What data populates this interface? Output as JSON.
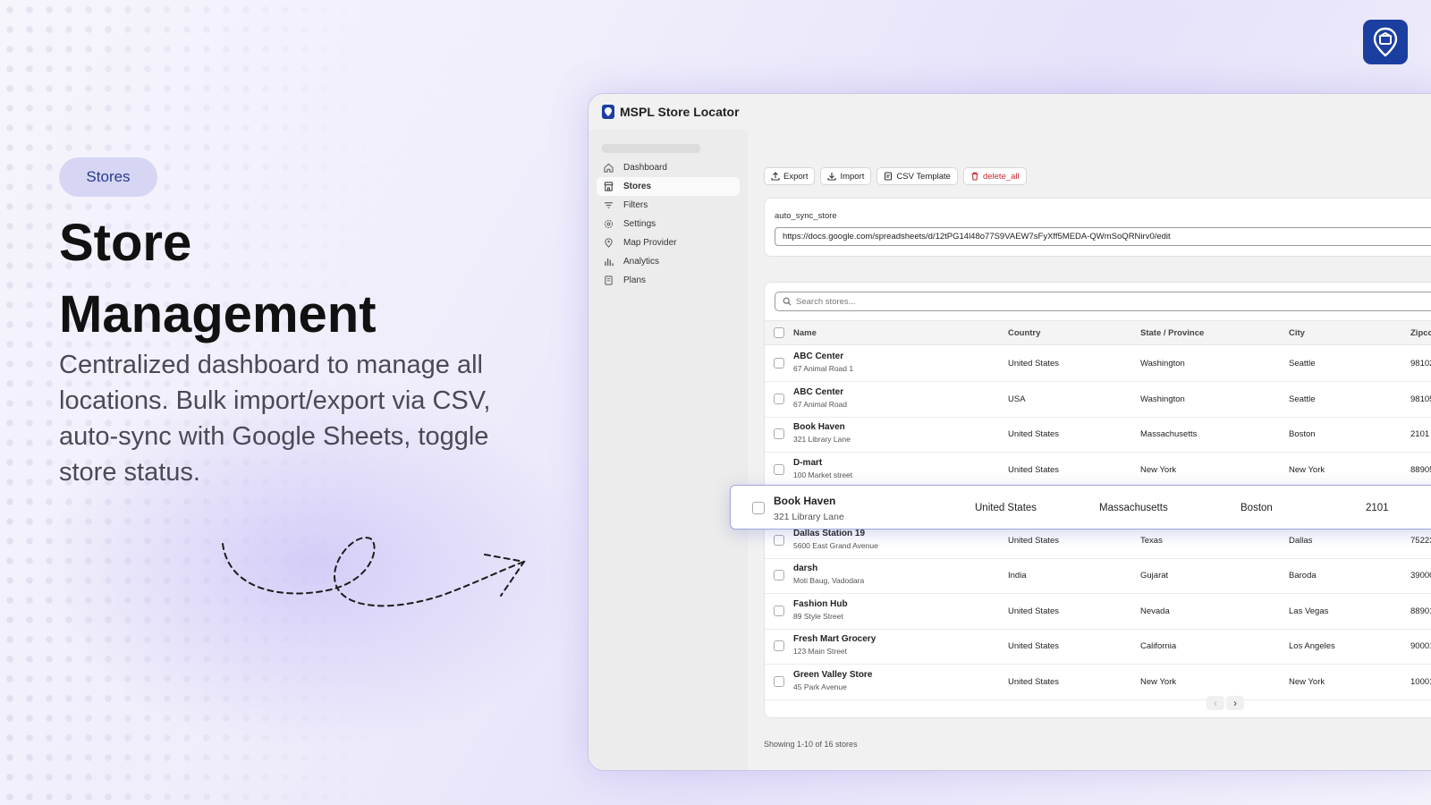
{
  "promo": {
    "pill": "Stores",
    "headline_line1": "Store",
    "headline_line2": "Management",
    "description": "Centralized dashboard to manage all locations. Bulk import/export via CSV, auto-sync with Google Sheets, toggle store status."
  },
  "app": {
    "title": "MSPL Store Locator",
    "sidebar": {
      "items": [
        {
          "label": "Dashboard",
          "icon": "home-icon"
        },
        {
          "label": "Stores",
          "icon": "store-icon",
          "active": true
        },
        {
          "label": "Filters",
          "icon": "filter-icon"
        },
        {
          "label": "Settings",
          "icon": "gear-icon"
        },
        {
          "label": "Map Provider",
          "icon": "pin-icon"
        },
        {
          "label": "Analytics",
          "icon": "bar-chart-icon"
        },
        {
          "label": "Plans",
          "icon": "document-icon"
        }
      ]
    },
    "toolbar": {
      "export": "Export",
      "import": "Import",
      "csv_template": "CSV Template",
      "delete_all": "delete_all"
    },
    "sync": {
      "label": "auto_sync_store",
      "value": "https://docs.google.com/spreadsheets/d/12tPG14l48o77S9VAEW7sFyXff5MEDA-QWmSoQRNirv0/edit"
    },
    "search": {
      "placeholder": "Search stores..."
    },
    "table": {
      "headers": {
        "name": "Name",
        "country": "Country",
        "state": "State / Province",
        "city": "City",
        "zip": "Zipco"
      },
      "rows": [
        {
          "name": "ABC Center",
          "address": "67 Animal Road 1",
          "country": "United States",
          "state": "Washington",
          "city": "Seattle",
          "zip": "98102"
        },
        {
          "name": "ABC Center",
          "address": "67 Animal Road",
          "country": "USA",
          "state": "Washington",
          "city": "Seattle",
          "zip": "98105"
        },
        {
          "name": "Book Haven",
          "address": "321 Library Lane",
          "country": "United States",
          "state": "Massachusetts",
          "city": "Boston",
          "zip": "2101"
        },
        {
          "name": "D-mart",
          "address": "100 Market street",
          "country": "United States",
          "state": "New York",
          "city": "New York",
          "zip": "88905"
        },
        {
          "name": "",
          "address": "",
          "country": "",
          "state": "",
          "city": "",
          "zip": ""
        },
        {
          "name": "Dallas Station 19",
          "address": "5600 East Grand Avenue",
          "country": "United States",
          "state": "Texas",
          "city": "Dallas",
          "zip": "75223"
        },
        {
          "name": "darsh",
          "address": "Moti Baug, Vadodara",
          "country": "India",
          "state": "Gujarat",
          "city": "Baroda",
          "zip": "39000"
        },
        {
          "name": "Fashion Hub",
          "address": "89 Style Street",
          "country": "United States",
          "state": "Nevada",
          "city": "Las Vegas",
          "zip": "88901"
        },
        {
          "name": "Fresh Mart Grocery",
          "address": "123 Main Street",
          "country": "United States",
          "state": "California",
          "city": "Los Angeles",
          "zip": "90001"
        },
        {
          "name": "Green Valley Store",
          "address": "45 Park Avenue",
          "country": "United States",
          "state": "New York",
          "city": "New York",
          "zip": "10001"
        }
      ]
    },
    "highlight_row": {
      "name": "Book Haven",
      "address": "321 Library Lane",
      "country": "United States",
      "state": "Massachusetts",
      "city": "Boston",
      "zip": "2101"
    },
    "pager": {
      "prev": "‹",
      "next": "›"
    },
    "footer": "Showing 1-10 of 16 stores"
  },
  "colors": {
    "brand": "#1b3fa0",
    "danger": "#c5282f",
    "pill_bg": "#d6d6f4"
  }
}
